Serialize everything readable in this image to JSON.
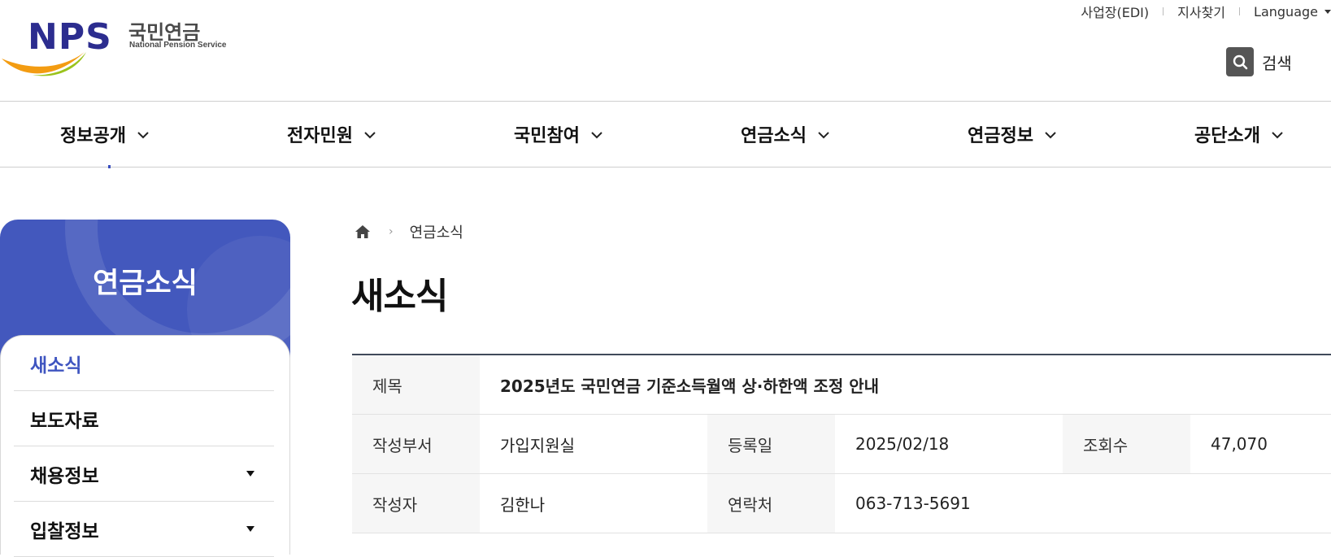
{
  "logo": {
    "mark": "NPS",
    "name_kr": "국민연금",
    "name_en": "National Pension Service"
  },
  "utility": {
    "edi": "사업장(EDI)",
    "branch": "지사찾기",
    "language": "Language"
  },
  "search": {
    "label": "검색",
    "icon": "search-icon"
  },
  "gnb": [
    "정보공개",
    "전자민원",
    "국민참여",
    "연금소식",
    "연금정보",
    "공단소개"
  ],
  "sidebar": {
    "title": "연금소식",
    "items": [
      {
        "label": "새소식",
        "active": true
      },
      {
        "label": "보도자료"
      },
      {
        "label": "채용정보",
        "has_sub": true
      },
      {
        "label": "입찰정보",
        "has_sub": true
      }
    ]
  },
  "breadcrumb": {
    "home_icon": "home-icon",
    "current": "연금소식"
  },
  "page_title": "새소식",
  "article": {
    "title_label": "제목",
    "title": "2025년도 국민연금 기준소득월액 상·하한액 조정 안내",
    "dept_label": "작성부서",
    "dept": "가입지원실",
    "date_label": "등록일",
    "date": "2025/02/18",
    "views_label": "조회수",
    "views": "47,070",
    "author_label": "작성자",
    "author": "김한나",
    "contact_label": "연락처",
    "contact": "063-713-5691"
  },
  "colors": {
    "brand_navy": "#2c2d8f",
    "sidebar_blue": "#4358bd",
    "active_blue": "#3f55c0"
  }
}
